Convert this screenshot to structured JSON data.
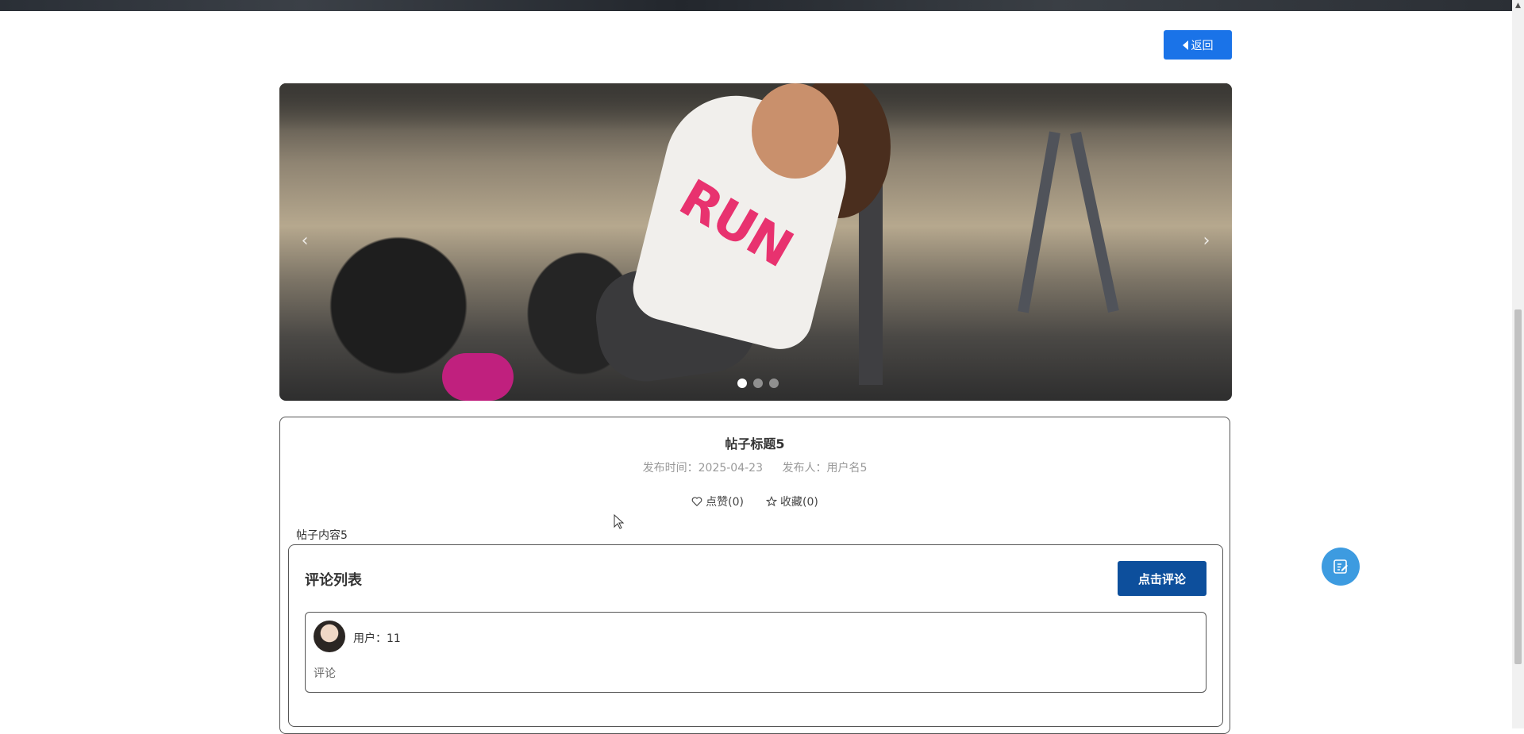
{
  "header": {
    "back_label": "返回"
  },
  "carousel": {
    "slide_text": "RUN",
    "prev_icon": "chevron-left",
    "next_icon": "chevron-right",
    "slide_count": 3,
    "active_index": 0
  },
  "post": {
    "title": "帖子标题5",
    "publish_time_label": "发布时间：",
    "publish_time": "2025-04-23",
    "author_label": "发布人：",
    "author": "用户名5",
    "like_label": "点赞(0)",
    "favorite_label": "收藏(0)",
    "content": "帖子内容5"
  },
  "comments": {
    "heading": "评论列表",
    "add_button": "点击评论",
    "items": [
      {
        "user_label": "用户：",
        "user": "11",
        "text": "评论"
      }
    ]
  },
  "colors": {
    "primary": "#1a73e8",
    "comment_button": "#0d4f9c",
    "float_button": "#3d9be0"
  }
}
